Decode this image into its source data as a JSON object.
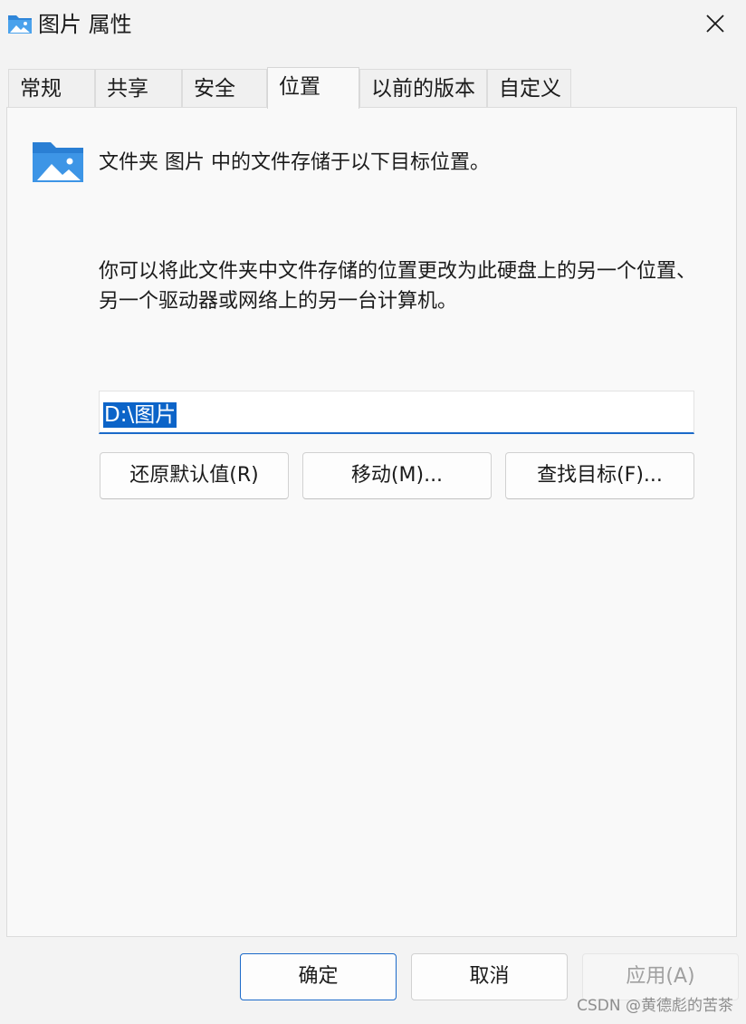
{
  "window": {
    "title": "图片 属性",
    "folder_icon": "pictures-folder-icon",
    "close_icon": "close-icon"
  },
  "tabs": [
    {
      "label": "常规"
    },
    {
      "label": "共享"
    },
    {
      "label": "安全"
    },
    {
      "label": "位置",
      "active": true
    },
    {
      "label": "以前的版本"
    },
    {
      "label": "自定义"
    }
  ],
  "location": {
    "intro": "文件夹 图片 中的文件存储于以下目标位置。",
    "description": "你可以将此文件夹中文件存储的位置更改为此硬盘上的另一个位置、另一个驱动器或网络上的另一台计算机。",
    "path_value": "D:\\图片",
    "restore_label": "还原默认值(R)",
    "move_label": "移动(M)...",
    "find_label": "查找目标(F)..."
  },
  "footer": {
    "ok_label": "确定",
    "cancel_label": "取消",
    "apply_label": "应用(A)"
  },
  "watermark": "CSDN @黄德彪的苦茶",
  "colors": {
    "accent": "#1b6ac9",
    "selection": "#0c64c8",
    "folder_blue": "#3a8ee0"
  }
}
